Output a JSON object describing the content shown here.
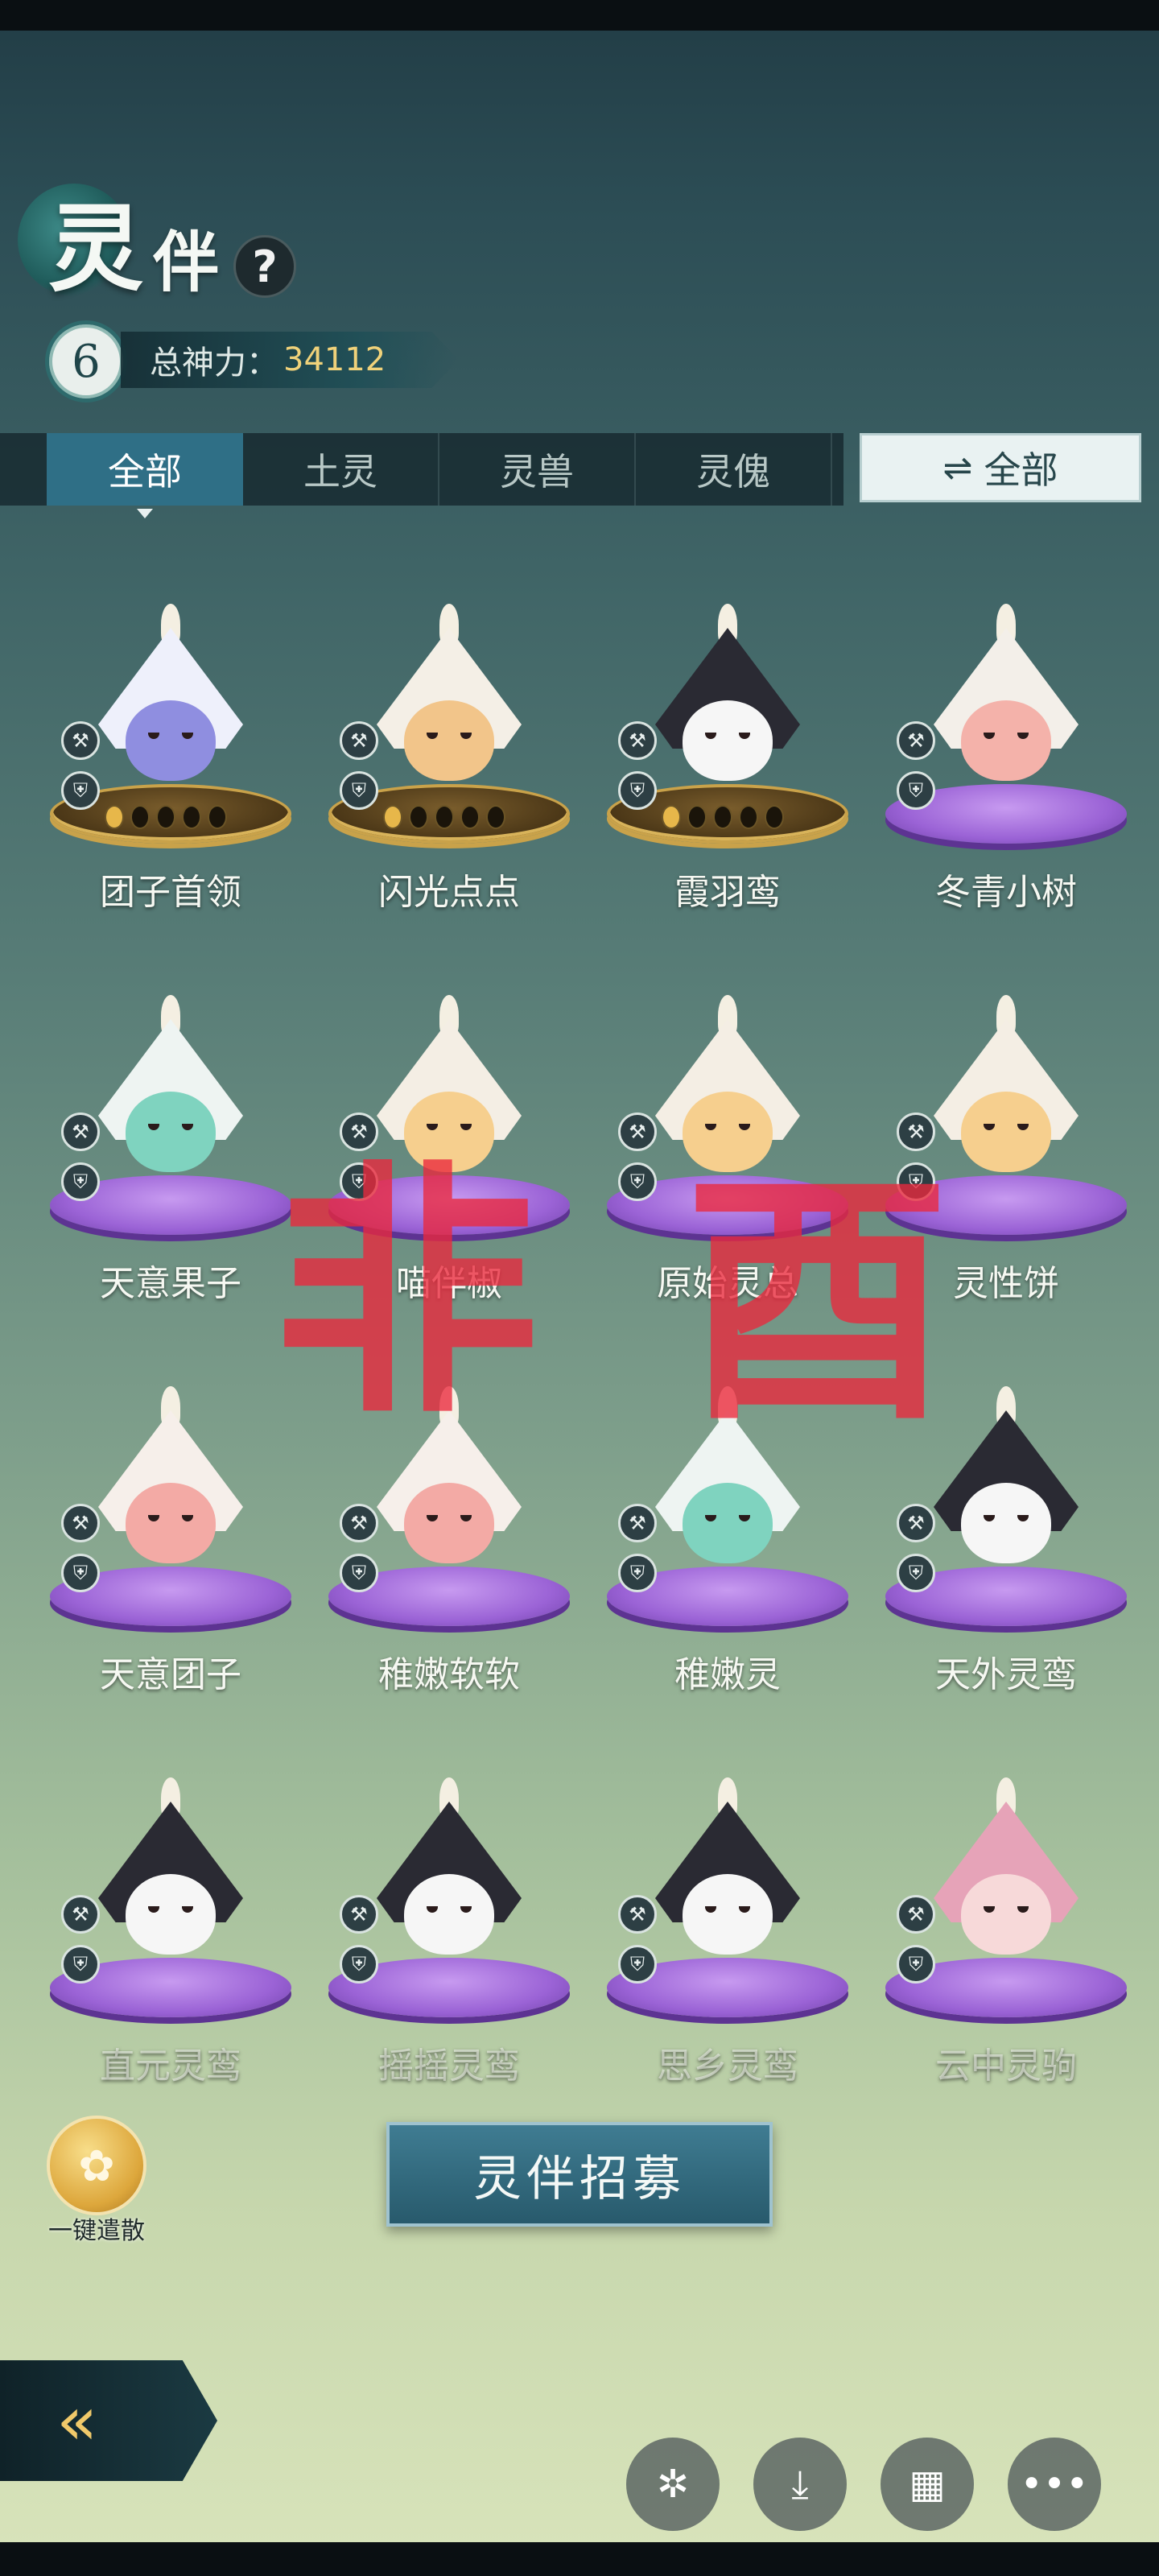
{
  "header": {
    "title_main": "灵",
    "title_sub": "伴",
    "help_glyph": "?",
    "level": "6",
    "power_label": "总神力：",
    "power_value": "34112"
  },
  "tabs": [
    {
      "label": "全部",
      "active": true
    },
    {
      "label": "土灵",
      "active": false
    },
    {
      "label": "灵兽",
      "active": false
    },
    {
      "label": "灵傀",
      "active": false
    }
  ],
  "filter": {
    "icon": "swap-icon",
    "glyph": "⇌",
    "label": "全部"
  },
  "companions": [
    {
      "name": "团子首领",
      "pedestal": "gold",
      "stars_lit": 1,
      "hat": "#eef0fb",
      "face": "#8f8ee0"
    },
    {
      "name": "闪光点点",
      "pedestal": "gold",
      "stars_lit": 1,
      "hat": "#f4efe6",
      "face": "#f2c58a"
    },
    {
      "name": "霞羽鸾",
      "pedestal": "gold",
      "stars_lit": 1,
      "hat": "#2a2a33",
      "face": "#f6f6f6"
    },
    {
      "name": "冬青小树",
      "pedestal": "purple",
      "hat": "#f3efe9",
      "face": "#f4b2aa"
    },
    {
      "name": "天意果子",
      "pedestal": "purple",
      "hat": "#eef4f2",
      "face": "#7fd3bf"
    },
    {
      "name": "喵伴椒",
      "pedestal": "purple",
      "hat": "#f4eee4",
      "face": "#f6cf8e"
    },
    {
      "name": "原始灵总",
      "pedestal": "purple",
      "hat": "#f4eee4",
      "face": "#f6cf8e"
    },
    {
      "name": "灵性饼",
      "pedestal": "purple",
      "hat": "#f4eee4",
      "face": "#f6cf8e"
    },
    {
      "name": "天意团子",
      "pedestal": "purple",
      "hat": "#f6efea",
      "face": "#f3aaa5"
    },
    {
      "name": "稚嫩软软",
      "pedestal": "purple",
      "hat": "#f6efea",
      "face": "#f3aaa5"
    },
    {
      "name": "稚嫩灵",
      "pedestal": "purple",
      "hat": "#eef4f2",
      "face": "#7fd3bf"
    },
    {
      "name": "天外灵鸾",
      "pedestal": "purple",
      "hat": "#2a2a33",
      "face": "#f6f6f6"
    },
    {
      "name": "直元灵鸾",
      "pedestal": "purple",
      "hat": "#2a2a33",
      "face": "#f6f6f6",
      "faded": true
    },
    {
      "name": "摇摇灵鸾",
      "pedestal": "purple",
      "hat": "#2a2a33",
      "face": "#f6f6f6",
      "faded": true
    },
    {
      "name": "思乡灵鸾",
      "pedestal": "purple",
      "hat": "#2a2a33",
      "face": "#f6f6f6",
      "faded": true
    },
    {
      "name": "云中灵驹",
      "pedestal": "purple",
      "hat": "#e6a3b8",
      "face": "#f7d9d9",
      "faded": true
    }
  ],
  "watermark": {
    "left": "非",
    "right": "酉"
  },
  "actions": {
    "dismiss_label": "一键遣散",
    "dismiss_glyph": "✿",
    "recruit_label": "灵伴招募",
    "back_glyph": "«"
  },
  "fabs": [
    {
      "icon": "sparkle-icon",
      "glyph": "✲"
    },
    {
      "icon": "download-icon",
      "glyph": "⤓"
    },
    {
      "icon": "grid-icon",
      "glyph": "▦"
    },
    {
      "icon": "more-icon",
      "glyph": "•••"
    }
  ],
  "colors": {
    "accent": "#2f6f86",
    "gold": "#e7b74a",
    "watermark": "#eb283c"
  }
}
